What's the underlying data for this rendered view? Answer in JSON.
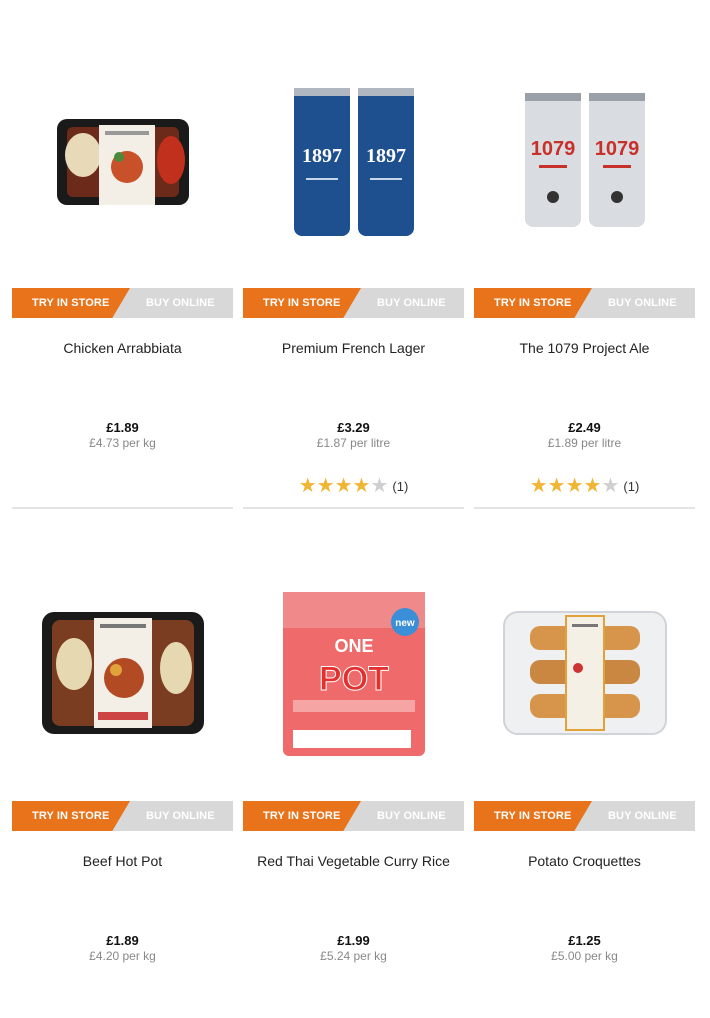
{
  "buttons": {
    "try_in_store": "TRY IN STORE",
    "buy_online": "BUY ONLINE"
  },
  "products": [
    {
      "title": "Chicken Arrabbiata",
      "price": "£1.89",
      "unit_price": "£4.73 per kg",
      "rating": null,
      "reviews": null,
      "image": "ready-meal-tray"
    },
    {
      "title": "Premium French Lager",
      "price": "£3.29",
      "unit_price": "£1.87 per litre",
      "rating": 4,
      "reviews": "(1)",
      "image": "lager-cans-1897",
      "can_text": "1897"
    },
    {
      "title": "The 1079 Project Ale",
      "price": "£2.49",
      "unit_price": "£1.89 per litre",
      "rating": 4,
      "reviews": "(1)",
      "image": "ale-cans-1079",
      "can_text": "1079"
    },
    {
      "title": "Beef Hot Pot",
      "price": "£1.89",
      "unit_price": "£4.20 per kg",
      "rating": null,
      "reviews": null,
      "image": "ready-meal-tray"
    },
    {
      "title": "Red Thai Vegetable Curry Rice",
      "price": "£1.99",
      "unit_price": "£5.24 per kg",
      "rating": null,
      "reviews": null,
      "image": "one-pot-box",
      "pack_text": [
        "ONE",
        "POT"
      ],
      "badge": "new"
    },
    {
      "title": "Potato Croquettes",
      "price": "£1.25",
      "unit_price": "£5.00 per kg",
      "rating": null,
      "reviews": null,
      "image": "croquettes-tray"
    }
  ],
  "colors": {
    "accent": "#e8731a",
    "grey_button": "#d8d8d8",
    "star": "#f1b534"
  }
}
